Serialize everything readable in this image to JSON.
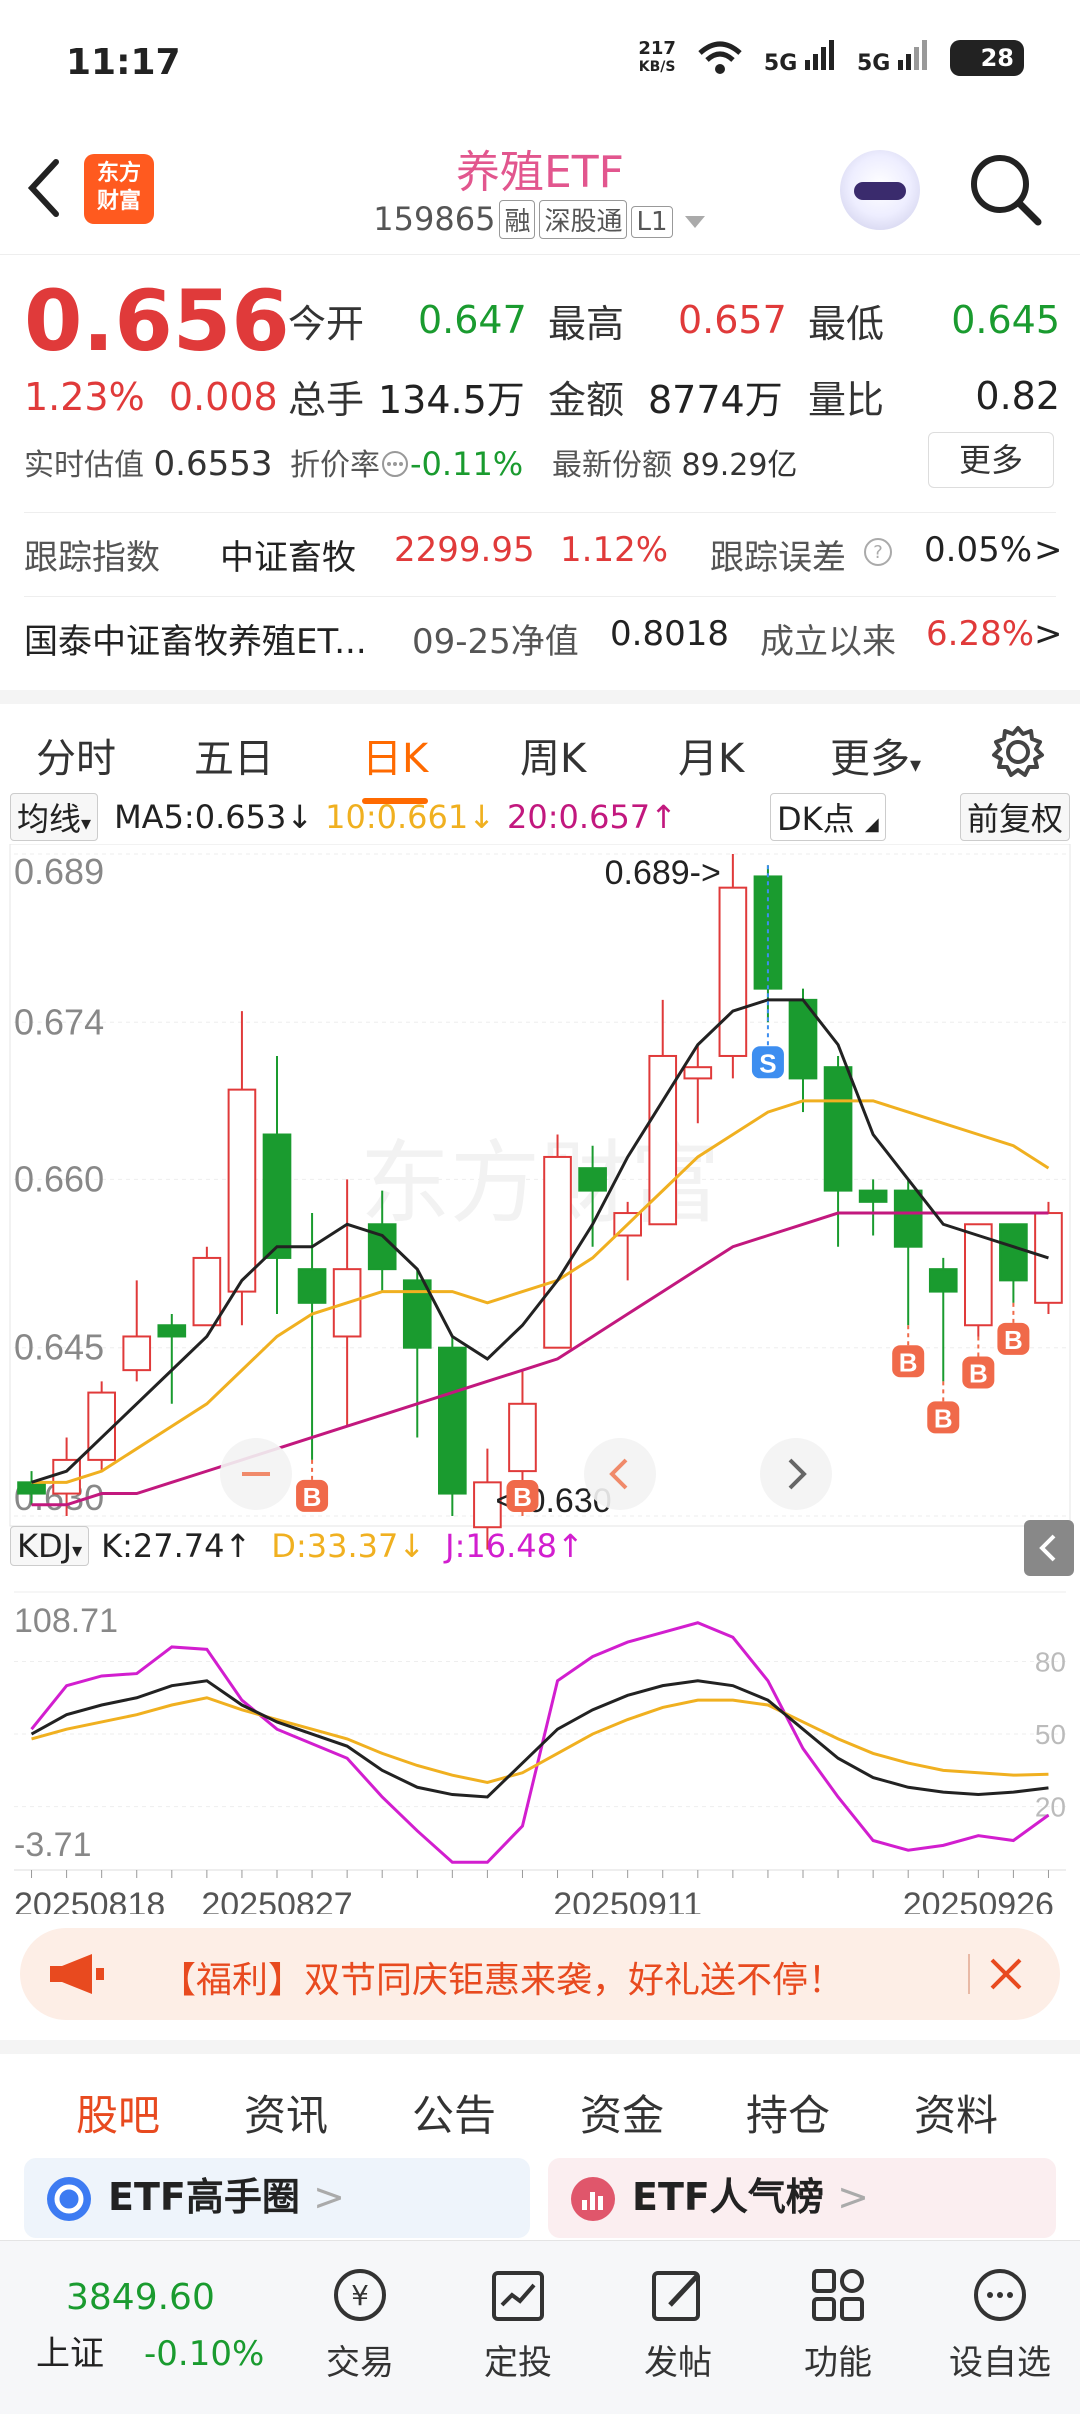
{
  "status": {
    "time": "11:17",
    "speed_value": "217",
    "speed_unit": "KB/S",
    "sig1": "5G",
    "sig2": "5G",
    "battery": "28"
  },
  "header": {
    "logo_line1": "东方",
    "logo_line2": "财富",
    "title": "养殖ETF",
    "code": "159865",
    "tags": [
      "融",
      "深股通",
      "L1"
    ]
  },
  "quote": {
    "price": "0.656",
    "pct": "1.23%",
    "change": "0.008",
    "open_label": "今开",
    "open": "0.647",
    "high_label": "最高",
    "high": "0.657",
    "low_label": "最低",
    "low": "0.645",
    "vol_label": "总手",
    "vol": "134.5万",
    "amt_label": "金额",
    "amt": "8774万",
    "ratio_label": "量比",
    "ratio": "0.82",
    "est_label": "实时估值",
    "est": "0.6553",
    "disc_label": "折价率",
    "disc": "-0.11%",
    "share_label": "最新份额",
    "share": "89.29亿",
    "more": "更多"
  },
  "track": {
    "label": "跟踪指数",
    "index": "中证畜牧",
    "value": "2299.95",
    "pct": "1.12%",
    "err_label": "跟踪误差",
    "err": "0.05%",
    "arrow": ">"
  },
  "fund": {
    "name": "国泰中证畜牧养殖ET...",
    "nav_label": "09-25净值",
    "nav": "0.8018",
    "since_label": "成立以来",
    "since": "6.28%",
    "arrow": ">"
  },
  "period_tabs": [
    "分时",
    "五日",
    "日K",
    "周K",
    "月K",
    "更多"
  ],
  "ma": {
    "select": "均线",
    "ma5": "MA5:0.653",
    "ma10": "10:0.661",
    "ma20": "20:0.657",
    "dk": "DK点",
    "adj": "前复权"
  },
  "kdj": {
    "select": "KDJ",
    "k": "K:27.74",
    "d": "D:33.37",
    "j": "J:16.48"
  },
  "chart_data": {
    "type": "candlestick",
    "price_axis": [
      "0.689",
      "0.674",
      "0.660",
      "0.645",
      "0.630"
    ],
    "ylim": [
      0.63,
      0.689
    ],
    "max_label": "0.689->",
    "min_label": "<-0.630",
    "watermark": "东方财富",
    "candles": [
      {
        "o": 0.633,
        "c": 0.632,
        "h": 0.634,
        "l": 0.631
      },
      {
        "o": 0.632,
        "c": 0.635,
        "h": 0.637,
        "l": 0.63
      },
      {
        "o": 0.635,
        "c": 0.641,
        "h": 0.642,
        "l": 0.634
      },
      {
        "o": 0.643,
        "c": 0.646,
        "h": 0.651,
        "l": 0.642
      },
      {
        "o": 0.647,
        "c": 0.646,
        "h": 0.648,
        "l": 0.64
      },
      {
        "o": 0.647,
        "c": 0.653,
        "h": 0.654,
        "l": 0.647
      },
      {
        "o": 0.65,
        "c": 0.668,
        "h": 0.675,
        "l": 0.647
      },
      {
        "o": 0.664,
        "c": 0.653,
        "h": 0.671,
        "l": 0.648
      },
      {
        "o": 0.652,
        "c": 0.649,
        "h": 0.657,
        "l": 0.635
      },
      {
        "o": 0.646,
        "c": 0.652,
        "h": 0.66,
        "l": 0.638
      },
      {
        "o": 0.656,
        "c": 0.652,
        "h": 0.659,
        "l": 0.65
      },
      {
        "o": 0.651,
        "c": 0.645,
        "h": 0.652,
        "l": 0.637
      },
      {
        "o": 0.645,
        "c": 0.632,
        "h": 0.646,
        "l": 0.63
      },
      {
        "o": 0.629,
        "c": 0.633,
        "h": 0.636,
        "l": 0.627
      },
      {
        "o": 0.634,
        "c": 0.64,
        "h": 0.643,
        "l": 0.63
      },
      {
        "o": 0.645,
        "c": 0.662,
        "h": 0.664,
        "l": 0.645
      },
      {
        "o": 0.661,
        "c": 0.659,
        "h": 0.663,
        "l": 0.654
      },
      {
        "o": 0.655,
        "c": 0.657,
        "h": 0.658,
        "l": 0.651
      },
      {
        "o": 0.656,
        "c": 0.671,
        "h": 0.676,
        "l": 0.656
      },
      {
        "o": 0.669,
        "c": 0.67,
        "h": 0.672,
        "l": 0.665
      },
      {
        "o": 0.671,
        "c": 0.686,
        "h": 0.689,
        "l": 0.669
      },
      {
        "o": 0.687,
        "c": 0.677,
        "h": 0.688,
        "l": 0.674
      },
      {
        "o": 0.676,
        "c": 0.669,
        "h": 0.677,
        "l": 0.666
      },
      {
        "o": 0.67,
        "c": 0.659,
        "h": 0.671,
        "l": 0.654
      },
      {
        "o": 0.659,
        "c": 0.658,
        "h": 0.66,
        "l": 0.655
      },
      {
        "o": 0.659,
        "c": 0.654,
        "h": 0.66,
        "l": 0.647
      },
      {
        "o": 0.652,
        "c": 0.65,
        "h": 0.653,
        "l": 0.642
      },
      {
        "o": 0.647,
        "c": 0.656,
        "h": 0.656,
        "l": 0.646
      },
      {
        "o": 0.656,
        "c": 0.651,
        "h": 0.656,
        "l": 0.649
      },
      {
        "o": 0.649,
        "c": 0.657,
        "h": 0.658,
        "l": 0.648
      }
    ],
    "ma5": [
      0.633,
      0.634,
      0.637,
      0.64,
      0.643,
      0.646,
      0.651,
      0.654,
      0.654,
      0.656,
      0.655,
      0.652,
      0.646,
      0.644,
      0.647,
      0.651,
      0.656,
      0.662,
      0.667,
      0.672,
      0.675,
      0.676,
      0.676,
      0.672,
      0.664,
      0.66,
      0.656,
      0.655,
      0.654,
      0.653
    ],
    "ma10": [
      0.633,
      0.633,
      0.634,
      0.636,
      0.638,
      0.64,
      0.643,
      0.646,
      0.648,
      0.649,
      0.65,
      0.65,
      0.65,
      0.649,
      0.65,
      0.651,
      0.653,
      0.656,
      0.659,
      0.662,
      0.664,
      0.666,
      0.667,
      0.667,
      0.667,
      0.666,
      0.665,
      0.664,
      0.663,
      0.661
    ],
    "ma20": [
      0.631,
      0.631,
      0.632,
      0.632,
      0.633,
      0.634,
      0.635,
      0.636,
      0.637,
      0.638,
      0.639,
      0.64,
      0.641,
      0.642,
      0.643,
      0.644,
      0.646,
      0.648,
      0.65,
      0.652,
      0.654,
      0.655,
      0.656,
      0.657,
      0.657,
      0.657,
      0.657,
      0.657,
      0.657,
      0.657
    ],
    "signals": [
      {
        "i": 8,
        "type": "B"
      },
      {
        "i": 14,
        "type": "B"
      },
      {
        "i": 21,
        "type": "S"
      },
      {
        "i": 25,
        "type": "B"
      },
      {
        "i": 26,
        "type": "B"
      },
      {
        "i": 27,
        "type": "B"
      },
      {
        "i": 28,
        "type": "B"
      }
    ],
    "kdj_axis": [
      "108.71",
      "-3.71"
    ],
    "kdj_ylim": [
      -3.71,
      108.71
    ],
    "kdj_grid": [
      "80",
      "50",
      "20"
    ],
    "k": [
      50,
      58,
      62,
      65,
      70,
      72,
      62,
      55,
      50,
      45,
      35,
      28,
      25,
      24,
      38,
      52,
      60,
      66,
      70,
      72,
      70,
      64,
      52,
      40,
      32,
      28,
      26,
      25,
      26,
      27.74
    ],
    "d": [
      48,
      52,
      55,
      58,
      62,
      65,
      60,
      56,
      52,
      48,
      42,
      37,
      33,
      30,
      34,
      42,
      50,
      56,
      61,
      64,
      64,
      62,
      55,
      48,
      42,
      38,
      35,
      34,
      33,
      33.37
    ],
    "j": [
      52,
      70,
      74,
      75,
      86,
      85,
      64,
      52,
      46,
      40,
      24,
      10,
      -3,
      -3,
      12,
      72,
      82,
      88,
      92,
      96,
      90,
      72,
      44,
      24,
      6,
      2,
      4,
      8,
      6,
      16.48
    ],
    "x_ticks": [
      {
        "i": 0,
        "label": "20250818"
      },
      {
        "i": 7,
        "label": "20250827"
      },
      {
        "i": 17,
        "label": "20250911"
      },
      {
        "i": 27,
        "label": "20250926"
      }
    ]
  },
  "notice": {
    "text": "【福利】双节同庆钜惠来袭，好礼送不停！"
  },
  "info_tabs": [
    "股吧",
    "资讯",
    "公告",
    "资金",
    "持仓",
    "资料"
  ],
  "cards": [
    {
      "label": "ETF高手圈",
      "arrow": ">"
    },
    {
      "label": "ETF人气榜",
      "arrow": ">"
    }
  ],
  "bottom": {
    "index_value": "3849.60",
    "index_name": "上证",
    "index_pct": "-0.10%",
    "nav": [
      "交易",
      "定投",
      "发帖",
      "功能",
      "设自选"
    ]
  }
}
